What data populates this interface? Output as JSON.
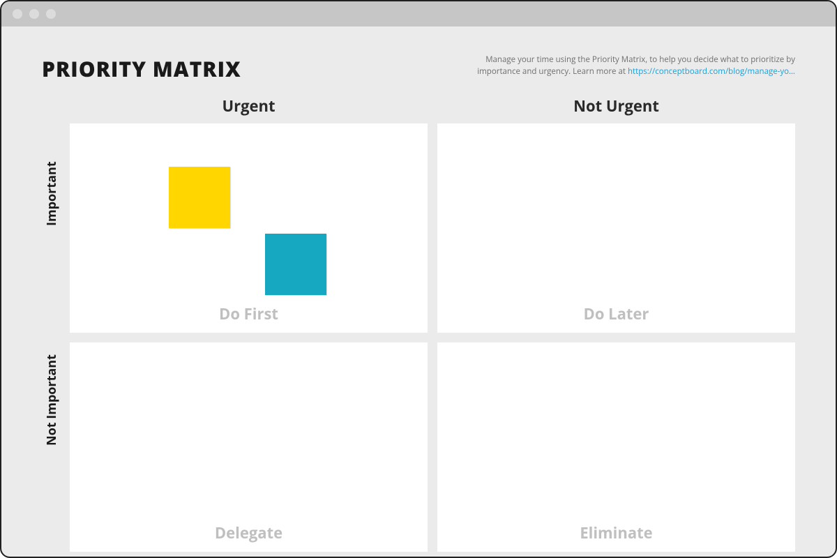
{
  "title": "PRIORITY MATRIX",
  "description": {
    "text": "Manage your time using the Priority Matrix, to help you decide what to prioritize by importance and urgency. Learn more at ",
    "link_label": "https://conceptboard.com/blog/manage-yo…"
  },
  "columns": {
    "urgent": "Urgent",
    "not_urgent": "Not Urgent"
  },
  "rows": {
    "important": "Important",
    "not_important": "Not Important"
  },
  "quadrants": {
    "do_first": "Do First",
    "do_later": "Do Later",
    "delegate": "Delegate",
    "eliminate": "Eliminate"
  },
  "stickies": [
    {
      "color": "#ffd600",
      "name": "yellow-sticky"
    },
    {
      "color": "#16a7c1",
      "name": "teal-sticky"
    }
  ]
}
